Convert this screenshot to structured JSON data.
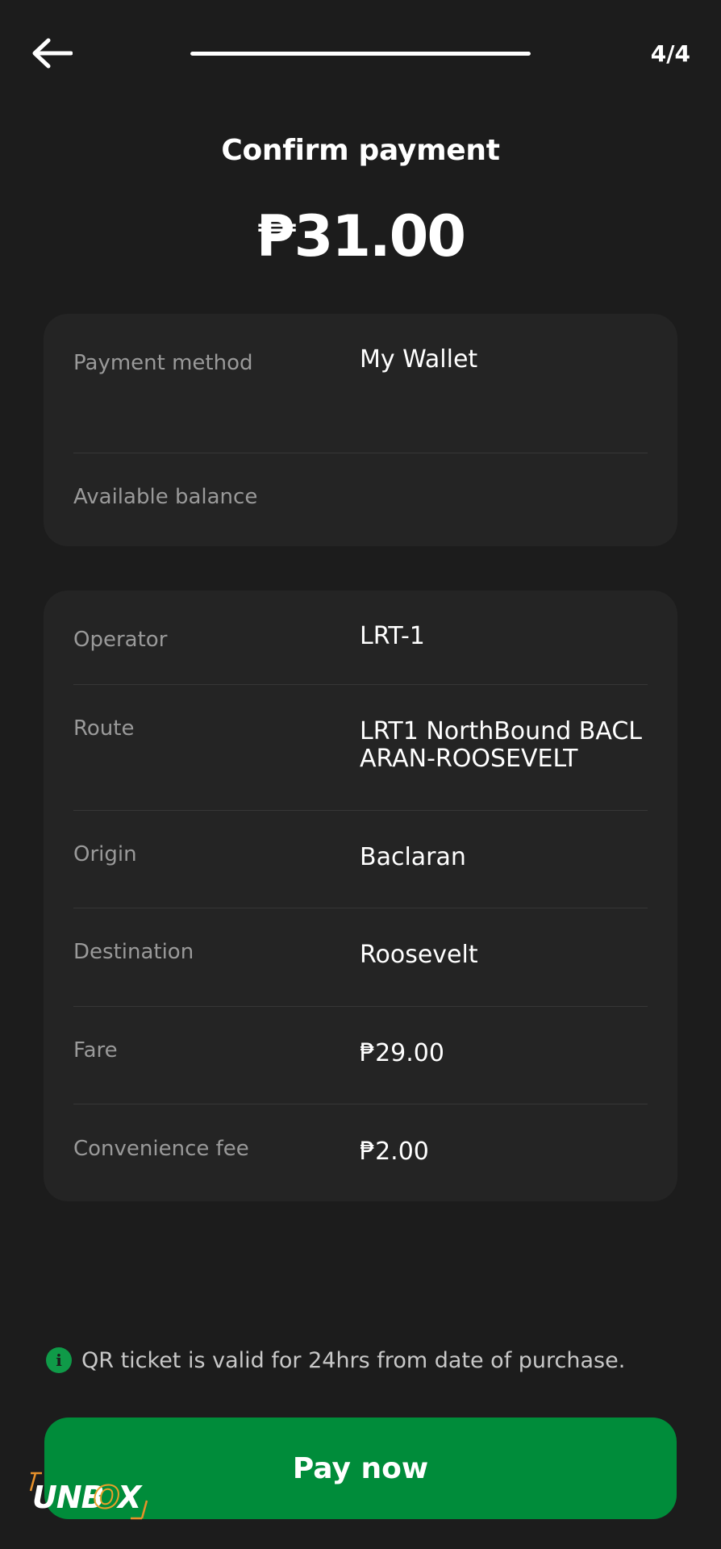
{
  "header": {
    "step_counter": "4/4",
    "progress_fraction": 1.0
  },
  "title": "Confirm payment",
  "amount": "₱31.00",
  "payment_card": {
    "rows": [
      {
        "label": "Payment method",
        "value": "My Wallet"
      },
      {
        "label": "Available balance",
        "value": ""
      }
    ]
  },
  "trip_card": {
    "rows": [
      {
        "label": "Operator",
        "value": "LRT-1"
      },
      {
        "label": "Route",
        "value": "LRT1 NorthBound BACLARAN-ROOSEVELT"
      },
      {
        "label": "Origin",
        "value": "Baclaran"
      },
      {
        "label": "Destination",
        "value": "Roosevelt"
      },
      {
        "label": "Fare",
        "value": "₱29.00"
      },
      {
        "label": "Convenience fee",
        "value": "₱2.00"
      }
    ]
  },
  "note": {
    "text": "QR ticket is valid for 24hrs from date of purchase.",
    "icon": "info-icon"
  },
  "pay_button": {
    "label": "Pay now"
  },
  "watermark": {
    "text": "UNBOX"
  },
  "colors": {
    "background": "#1c1c1c",
    "card": "#242424",
    "accent_green": "#008c3a",
    "info_green": "#0f9a48",
    "label_gray": "#9a9a9a"
  }
}
